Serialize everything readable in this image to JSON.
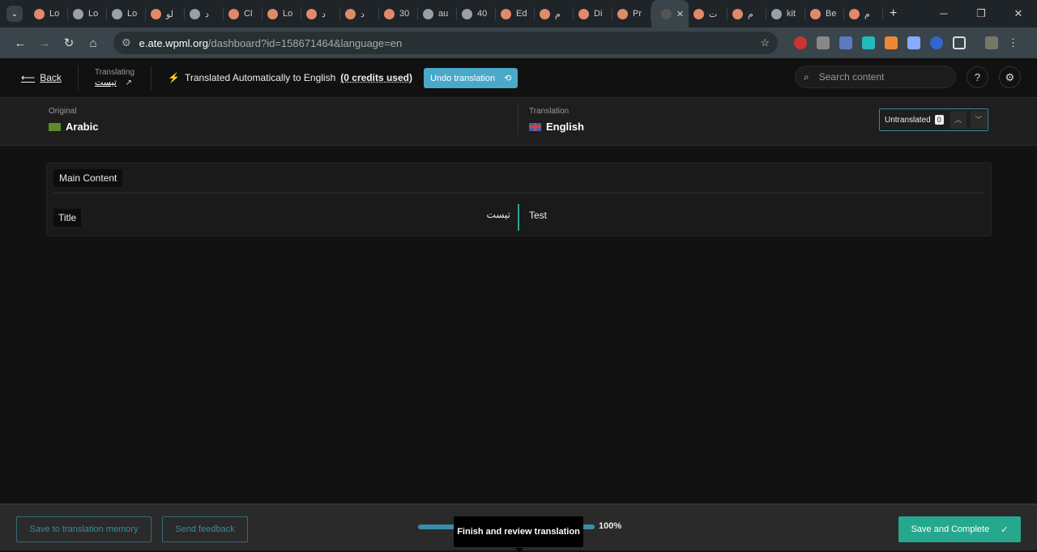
{
  "browser": {
    "tabs": [
      "Lo",
      "Lo",
      "Lo",
      "لو",
      "د",
      "Cl",
      "Lo",
      "د",
      "د",
      "30",
      "au",
      "40",
      "Ed",
      "م",
      "Di",
      "Pr",
      "",
      "ت",
      "م",
      "kit",
      "Be",
      "م"
    ],
    "url_domain": "e.ate.wpml.org",
    "url_path": "/dashboard?id=158671464&language=en"
  },
  "header": {
    "back": "Back",
    "translating_label": "Translating",
    "doc_title": "تيست",
    "auto_text": "Translated Automatically to English",
    "credits": "(0 credits used)",
    "undo": "Undo translation",
    "search_placeholder": "Search content"
  },
  "langs": {
    "original_label": "Original",
    "original": "Arabic",
    "translation_label": "Translation",
    "translation": "English",
    "untranslated": "Untranslated",
    "untranslated_count": "0"
  },
  "content": {
    "section": "Main Content",
    "rows": [
      {
        "label": "Title",
        "source": "تيست",
        "target": "Test"
      }
    ]
  },
  "footer": {
    "save_memory": "Save to translation memory",
    "feedback": "Send feedback",
    "progress": "100%",
    "tooltip": "Finish and review translation",
    "save_complete": "Save and Complete"
  },
  "colors": {
    "accent": "#4aa8c9",
    "save": "#25a88e"
  }
}
